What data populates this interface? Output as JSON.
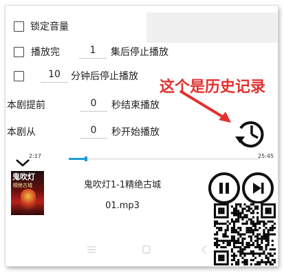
{
  "settings": {
    "lock_volume": {
      "label": "锁定音量",
      "checked": false
    },
    "stop_after_episodes": {
      "label_before": "播放完",
      "value": "1",
      "label_after": "集后停止播放",
      "checked": false
    },
    "stop_after_minutes": {
      "value": "10",
      "label_after": "分钟后停止播放",
      "checked": false
    },
    "end_early": {
      "label_before": "本剧提前",
      "value": "0",
      "label_after": "秒结束播放"
    },
    "start_from": {
      "label_before": "本剧从",
      "value": "0",
      "label_after": "秒开始播放"
    }
  },
  "annotation": {
    "text": "这个是历史记录",
    "color": "#e23030"
  },
  "icons": {
    "history": "history-clock-icon",
    "collapse": "chevron-down-icon",
    "pause": "pause-icon",
    "next": "skip-next-icon",
    "menu": "menu-icon",
    "home": "home-icon",
    "back": "back-icon"
  },
  "player": {
    "elapsed": "2:17",
    "duration": "25:45",
    "progress_fraction": 0.09,
    "track_title": "鬼吹灯1-1精绝古城",
    "track_file": "01.mp3",
    "accent_color": "#1f9bd7"
  },
  "cover": {
    "title": "鬼吹灯",
    "subtitle": "精绝古城"
  }
}
